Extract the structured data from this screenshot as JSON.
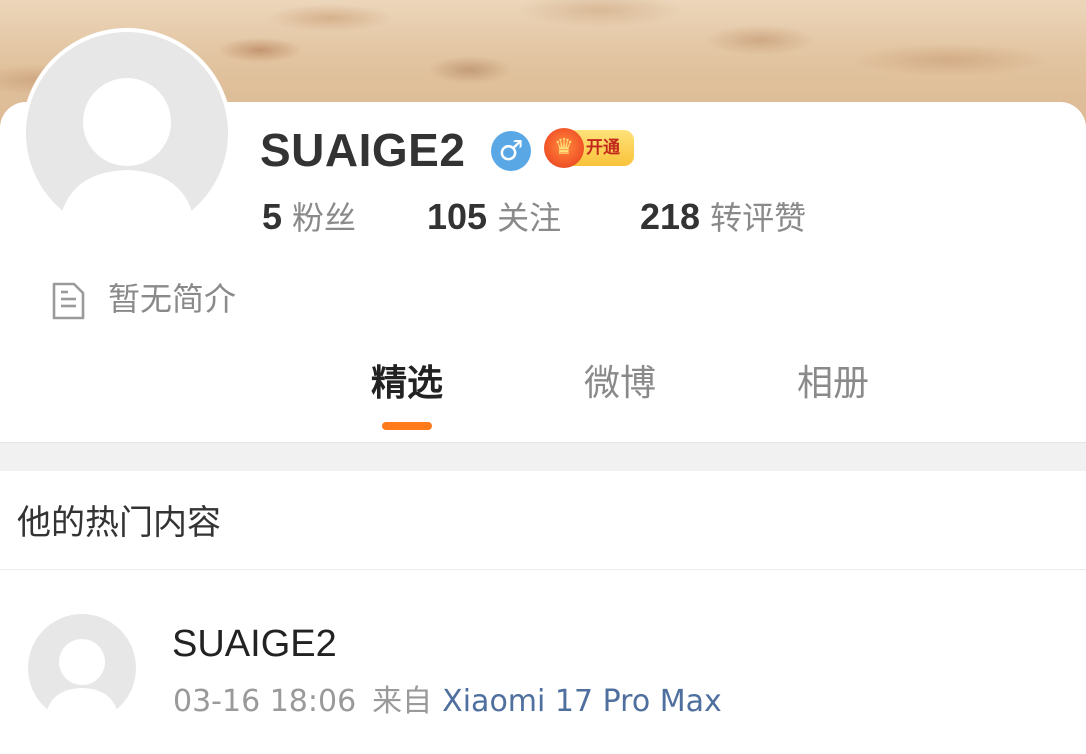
{
  "profile": {
    "username": "SUAIGE2",
    "gender_symbol": "♂",
    "vip_label": "开通",
    "stats": [
      {
        "value": "5",
        "label": "粉丝"
      },
      {
        "value": "105",
        "label": "关注"
      },
      {
        "value": "218",
        "label": "转评赞"
      }
    ],
    "intro": "暂无简介"
  },
  "tabs": [
    {
      "label": "精选",
      "active": true
    },
    {
      "label": "微博",
      "active": false
    },
    {
      "label": "相册",
      "active": false
    }
  ],
  "section": {
    "title": "他的热门内容"
  },
  "post": {
    "username": "SUAIGE2",
    "time": "03-16 18:06",
    "from_label": "来自",
    "device": "Xiaomi 17 Pro Max"
  },
  "colors": {
    "accent": "#ff7a1a",
    "gender_badge": "#5aa7e6",
    "device_link": "#4f6f9e"
  },
  "icons": [
    "avatar-placeholder-icon",
    "male-gender-icon",
    "vip-crown-icon",
    "document-icon"
  ]
}
